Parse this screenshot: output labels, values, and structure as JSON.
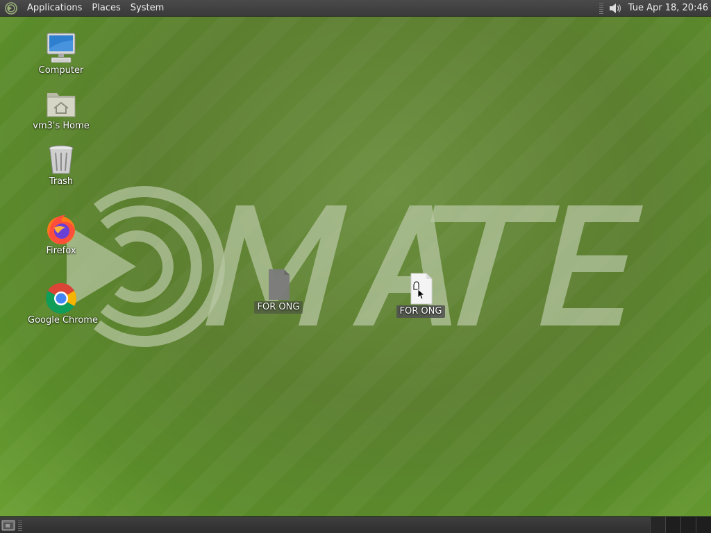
{
  "top_panel": {
    "menus": {
      "applications": "Applications",
      "places": "Places",
      "system": "System"
    },
    "clock": "Tue Apr 18, 20:46"
  },
  "desktop": {
    "wallpaper_text": "MATE",
    "icons": {
      "computer": "Computer",
      "home": "vm3's Home",
      "trash": "Trash",
      "firefox": "Firefox",
      "chrome": "Google Chrome"
    },
    "files": {
      "ghost": "FOR ONG",
      "dragged": "FOR ONG"
    }
  },
  "colors": {
    "panel_bg": "#3c3c3c",
    "wallpaper_green": "#6f9a3a",
    "logo_overlay": "#b9c7a3"
  },
  "icon_names": {
    "menu": "mate-menu-icon",
    "volume": "speaker-icon",
    "show_desktop": "show-desktop-icon"
  }
}
